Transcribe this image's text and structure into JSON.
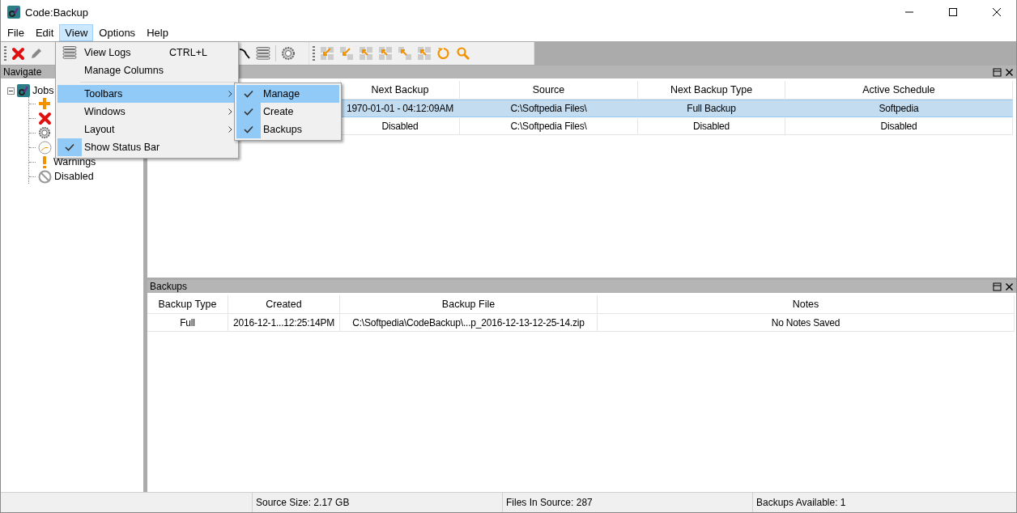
{
  "window": {
    "title": "Code:Backup"
  },
  "menu_bar": [
    {
      "label": "File",
      "selected": false
    },
    {
      "label": "Edit",
      "selected": false
    },
    {
      "label": "View",
      "selected": true
    },
    {
      "label": "Options",
      "selected": false
    },
    {
      "label": "Help",
      "selected": false
    }
  ],
  "view_menu": [
    {
      "kind": "icon_item",
      "label": "View Logs",
      "shortcut": "CTRL+L",
      "checked": false,
      "submenu": false,
      "selected": false
    },
    {
      "kind": "item",
      "label": "Manage Columns",
      "checked": false,
      "submenu": false,
      "selected": false
    },
    {
      "kind": "separator"
    },
    {
      "kind": "item",
      "label": "Toolbars",
      "checked": false,
      "submenu": true,
      "selected": true
    },
    {
      "kind": "item",
      "label": "Windows",
      "checked": false,
      "submenu": true,
      "selected": false
    },
    {
      "kind": "item",
      "label": "Layout",
      "checked": false,
      "submenu": true,
      "selected": false
    },
    {
      "kind": "item",
      "label": "Show Status Bar",
      "checked": true,
      "submenu": false,
      "selected": false
    }
  ],
  "toolbars_submenu": [
    {
      "label": "Manage",
      "checked": true,
      "selected": true
    },
    {
      "label": "Create",
      "checked": true,
      "selected": false
    },
    {
      "label": "Backups",
      "checked": true,
      "selected": false
    }
  ],
  "navigate": {
    "title": "Navigate",
    "tree": [
      {
        "label": "Jobs",
        "kind": "root",
        "expanded": true,
        "children": [
          {
            "kind": "add"
          },
          {
            "kind": "error"
          },
          {
            "kind": "running"
          },
          {
            "kind": "scheduled"
          },
          {
            "kind": "warning",
            "label": "Warnings"
          },
          {
            "kind": "disabled",
            "label": "Disabled"
          }
        ]
      }
    ]
  },
  "jobs": {
    "columns": [
      "Next Backup",
      "Source",
      "Next Backup Type",
      "Active Schedule"
    ],
    "rows": [
      {
        "selected": true,
        "cells": [
          "1970-01-01 - 04:12:09AM",
          "C:\\Softpedia Files\\",
          "Full Backup",
          "Softpedia"
        ]
      },
      {
        "selected": false,
        "cells": [
          "Disabled",
          "C:\\Softpedia Files\\",
          "Disabled",
          "Disabled"
        ]
      }
    ]
  },
  "backups": {
    "title": "Backups",
    "columns": [
      "Backup Type",
      "Created",
      "Backup File",
      "Notes"
    ],
    "rows": [
      {
        "selected": false,
        "cells": [
          "Full",
          "2016-12-1...12:25:14PM",
          "C:\\Softpedia\\CodeBackup\\...p_2016-12-13-12-25-14.zip",
          "No Notes Saved"
        ]
      }
    ]
  },
  "status_bar": [
    "Source Size: 2.17 GB",
    "Files In Source: 287",
    "Backups Available: 1"
  ]
}
